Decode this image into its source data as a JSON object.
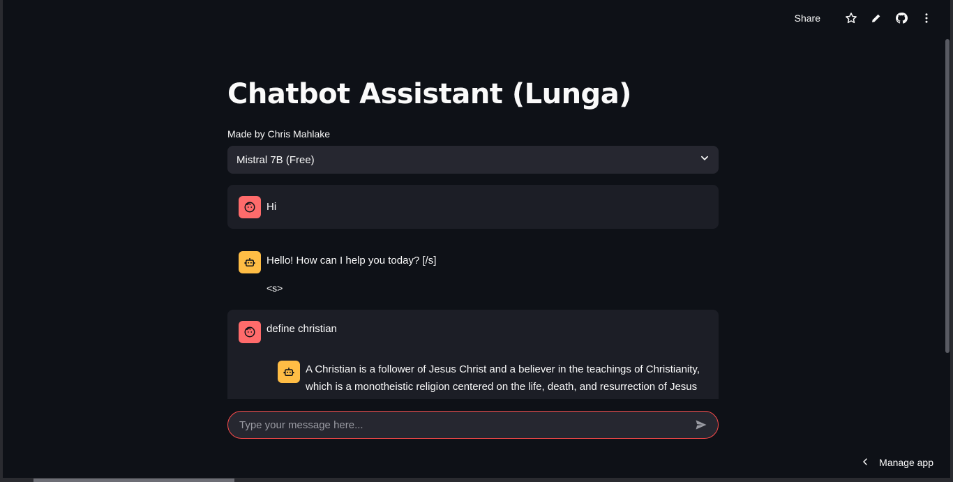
{
  "toolbar": {
    "share_label": "Share",
    "icons": [
      "star-icon",
      "pencil-icon",
      "github-icon",
      "more-vertical-icon"
    ]
  },
  "header": {
    "title": "Chatbot Assistant (Lunga)",
    "caption": "Made by Chris Mahlake"
  },
  "model_select": {
    "selected": "Mistral 7B (Free)"
  },
  "chat": {
    "messages": [
      {
        "role": "user",
        "text": "Hi"
      },
      {
        "role": "assistant",
        "text": "Hello! How can I help you today? [/s]",
        "extra": "<s>"
      },
      {
        "role": "user",
        "text": "define christian"
      },
      {
        "role": "assistant",
        "lines": [
          "A Christian is a follower of Jesus Christ and a believer in the teachings of Christianity,",
          "which is a monotheistic religion centered on the life, death, and resurrection of Jesus"
        ]
      }
    ]
  },
  "input": {
    "placeholder": "Type your message here..."
  },
  "footer": {
    "manage_label": "Manage app"
  },
  "colors": {
    "accent": "#ff4b4b",
    "user_avatar": "#ff6b6b",
    "bot_avatar": "#ffbd45",
    "background": "#0e1117"
  }
}
